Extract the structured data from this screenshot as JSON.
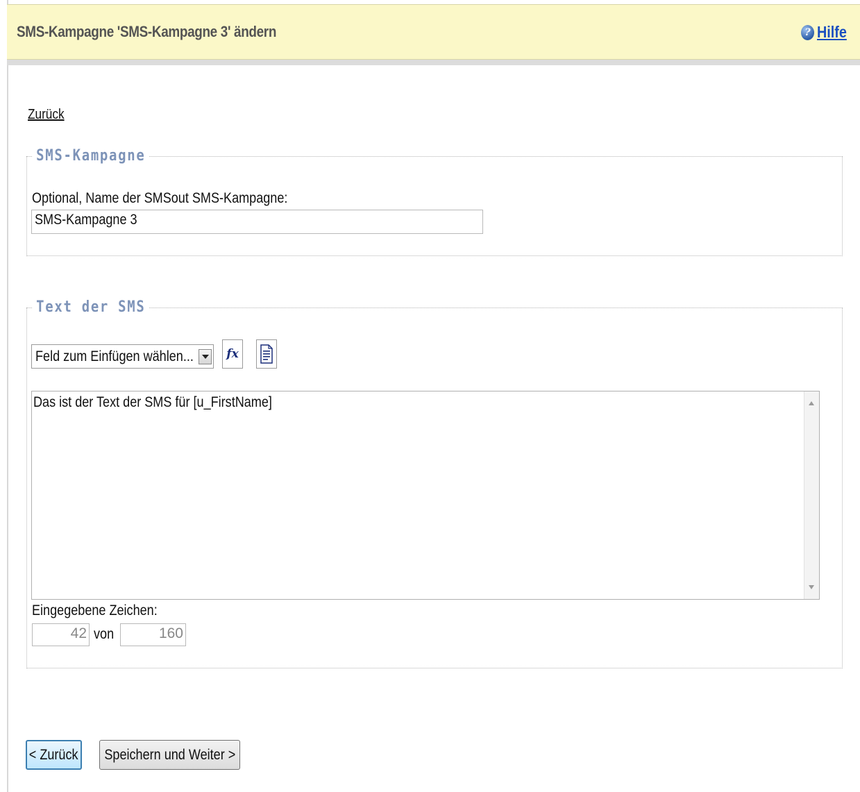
{
  "header": {
    "title": "SMS-Kampagne 'SMS-Kampagne 3' ändern",
    "help_label": "Hilfe",
    "help_icon": "help-question-icon"
  },
  "nav": {
    "back_link": "Zurück"
  },
  "campaign_section": {
    "legend": "SMS-Kampagne",
    "name_label": "Optional, Name der SMSout SMS-Kampagne:",
    "name_value": "SMS-Kampagne 3"
  },
  "text_section": {
    "legend": "Text der SMS",
    "field_select_value": "Feld zum Einfügen wählen...",
    "function_icon_label": "fx",
    "function_icon": "function-icon",
    "document_icon": "document-icon",
    "sms_text": "Das ist der Text der SMS für [u_FirstName]",
    "chars_label": "Eingegebene Zeichen:",
    "chars_entered": "42",
    "chars_of": "von",
    "chars_max": "160"
  },
  "buttons": {
    "back": "< Zurück",
    "save_next": "Speichern und Weiter >"
  },
  "colors": {
    "header_bg": "#fbf8c8",
    "legend": "#7d93b8",
    "link": "#1a4fc0",
    "back_button_border": "#3c7fb1"
  }
}
